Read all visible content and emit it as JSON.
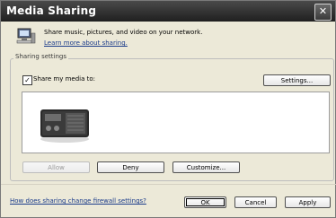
{
  "window": {
    "title": "Media Sharing",
    "close_glyph": "✕"
  },
  "intro": {
    "text": "Share music, pictures, and video on your network.",
    "link": "Learn more about sharing."
  },
  "sharing": {
    "group_label": "Sharing settings",
    "checkbox_label": "Share my media to:",
    "checkbox_checked": true,
    "settings_button": "Settings..."
  },
  "actions": {
    "allow": "Allow",
    "deny": "Deny",
    "customize": "Customize..."
  },
  "footer": {
    "link": "How does sharing change firewall settings?",
    "ok": "OK",
    "cancel": "Cancel",
    "apply": "Apply"
  },
  "icons": {
    "intro": "network-computer-icon",
    "device": "radio-device-icon"
  }
}
